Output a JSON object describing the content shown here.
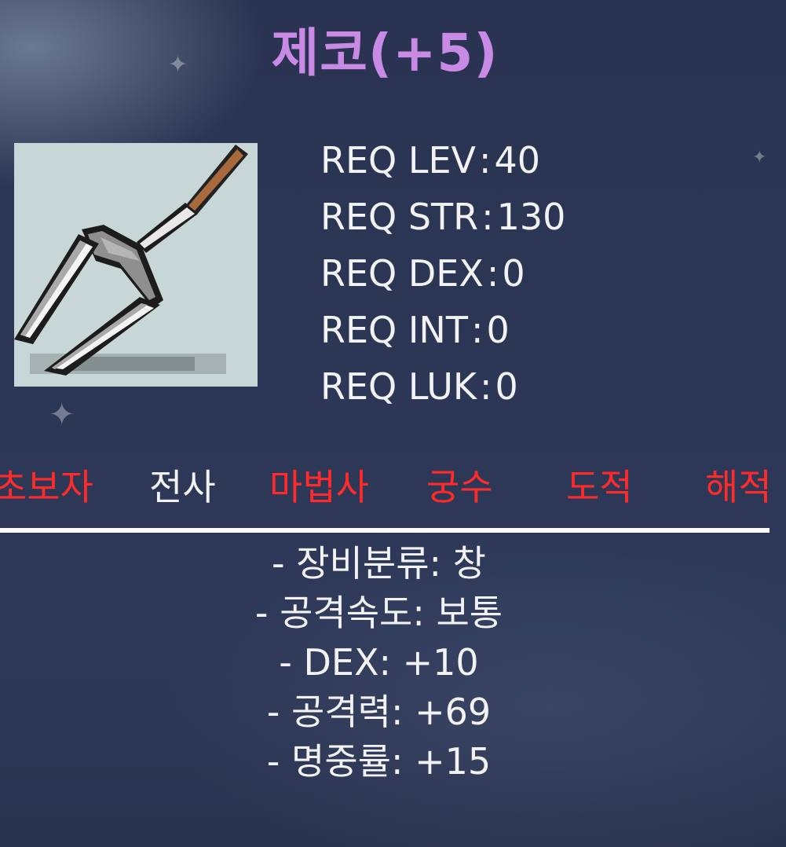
{
  "item": {
    "name": "제코(+5)",
    "icon": "spear-icon",
    "name_color": "#c98ae6"
  },
  "requirements": [
    {
      "label": "REQ LEV",
      "value": "40"
    },
    {
      "label": "REQ STR",
      "value": "130"
    },
    {
      "label": "REQ DEX",
      "value": "0"
    },
    {
      "label": "REQ INT",
      "value": "0"
    },
    {
      "label": "REQ LUK",
      "value": "0"
    }
  ],
  "jobs": [
    {
      "name": "초보자",
      "available": false,
      "color": "#ff2a2a"
    },
    {
      "name": "전사",
      "available": true,
      "color": "#f2f2f2"
    },
    {
      "name": "마법사",
      "available": false,
      "color": "#ff2a2a"
    },
    {
      "name": "궁수",
      "available": false,
      "color": "#ff2a2a"
    },
    {
      "name": "도적",
      "available": false,
      "color": "#ff2a2a"
    },
    {
      "name": "해적",
      "available": false,
      "color": "#ff2a2a"
    }
  ],
  "stats": [
    "- 장비분류: 창",
    "- 공격속도: 보통",
    "- DEX: +10",
    "- 공격력: +69",
    "- 명중률: +15"
  ]
}
